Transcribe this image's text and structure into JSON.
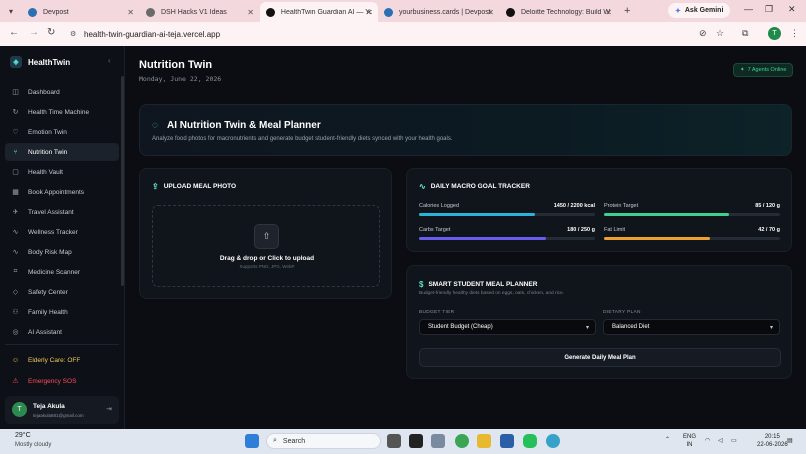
{
  "browser": {
    "tabs": [
      {
        "title": "Devpost",
        "color": "#2b6fb5",
        "active": false
      },
      {
        "title": "DSH Hacks V1 Ideas",
        "color": "#6a6a6a",
        "active": false
      },
      {
        "title": "HealthTwin Guardian AI — Yo",
        "color": "#111111",
        "active": true
      },
      {
        "title": "yourbusiness.cards | Devpost",
        "color": "#2b6fb5",
        "active": false
      },
      {
        "title": "Deloitte Technology: Build W",
        "color": "#111111",
        "active": false
      }
    ],
    "new_tab": "+",
    "gemini_label": "Ask Gemini",
    "url": "health-twin-guardian-ai-teja.vercel.app",
    "profile_initial": "T"
  },
  "sidebar": {
    "brand": "HealthTwin",
    "items": [
      {
        "label": "Dashboard",
        "icon": "◫"
      },
      {
        "label": "Health Time Machine",
        "icon": "↻"
      },
      {
        "label": "Emotion Twin",
        "icon": "♡"
      },
      {
        "label": "Nutrition Twin",
        "icon": "⑂",
        "active": true
      },
      {
        "label": "Health Vault",
        "icon": "▢"
      },
      {
        "label": "Book Appointments",
        "icon": "▦"
      },
      {
        "label": "Travel Assistant",
        "icon": "✈"
      },
      {
        "label": "Wellness Tracker",
        "icon": "∿"
      },
      {
        "label": "Body Risk Map",
        "icon": "∿"
      },
      {
        "label": "Medicine Scanner",
        "icon": "⌗"
      },
      {
        "label": "Safety Center",
        "icon": "◇"
      },
      {
        "label": "Family Health",
        "icon": "⚇"
      },
      {
        "label": "AI Assistant",
        "icon": "◎"
      }
    ],
    "elderly_care": "Elderly Care: OFF",
    "emergency": "Emergency SOS",
    "user": {
      "initial": "T",
      "name": "Teja Akula",
      "email": "tejaakula681@gmail.com"
    }
  },
  "header": {
    "title": "Nutrition Twin",
    "date": "Monday, June 22, 2026",
    "agents_badge": "7 Agents Online"
  },
  "hero": {
    "title": "AI Nutrition Twin & Meal Planner",
    "subtitle": "Analyze food photos for macronutrients and generate budget student-friendly diets synced with your health goals."
  },
  "upload": {
    "title": "UPLOAD MEAL PHOTO",
    "dropzone_title": "Drag & drop or Click to upload",
    "dropzone_sub": "Supports PNG, JPG, WebP"
  },
  "tracker": {
    "title": "DAILY MACRO GOAL TRACKER",
    "metrics": [
      {
        "label": "Calories Logged",
        "value": "1450 / 2200 kcal",
        "progress": 0.66,
        "color": "#2bb3d9"
      },
      {
        "label": "Protein Target",
        "value": "85 / 120 g",
        "progress": 0.71,
        "color": "#3fd08e"
      },
      {
        "label": "Carbs Target",
        "value": "180 / 250 g",
        "progress": 0.72,
        "color": "#6b5cf0"
      },
      {
        "label": "Fat Limit",
        "value": "42 / 70 g",
        "progress": 0.6,
        "color": "#f0a030"
      }
    ]
  },
  "planner": {
    "title": "SMART STUDENT MEAL PLANNER",
    "subtitle": "Budget-friendly healthy diets based on eggs, oats, chicken, and rice.",
    "budget_label": "BUDGET TIER",
    "budget_value": "Student Budget (Cheap)",
    "diet_label": "DIETARY PLAN",
    "diet_value": "Balanced Diet",
    "generate_label": "Generate Daily Meal Plan"
  },
  "taskbar": {
    "temp": "29°C",
    "weather": "Mostly cloudy",
    "search": "Search",
    "lang1": "ENG",
    "lang2": "IN",
    "time": "20:15",
    "date": "22-06-2026"
  }
}
